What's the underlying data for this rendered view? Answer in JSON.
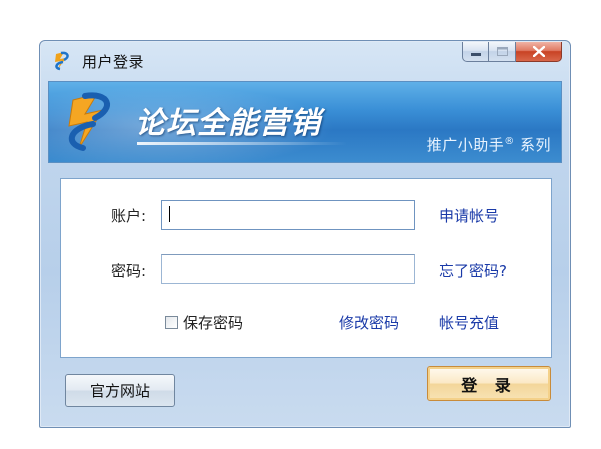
{
  "window": {
    "title": "用户登录"
  },
  "banner": {
    "title": "论坛全能营销",
    "subtitle": "推广小助手",
    "subtitle_mark": "®",
    "subtitle_suffix": " 系列"
  },
  "form": {
    "account_label": "账户:",
    "account_value": "",
    "password_label": "密码:",
    "password_value": "",
    "register_link": "申请帐号",
    "forgot_link": "忘了密码?",
    "save_password_label": "保存密码",
    "save_password_checked": false,
    "change_password_link": "修改密码",
    "recharge_link": "帐号充值"
  },
  "buttons": {
    "official_site": "官方网站",
    "login": "登 录"
  },
  "colors": {
    "banner_blue": "#3a8fd6",
    "link_blue": "#1a3aa8",
    "close_red": "#c84224",
    "login_amber": "#f3d69a"
  }
}
